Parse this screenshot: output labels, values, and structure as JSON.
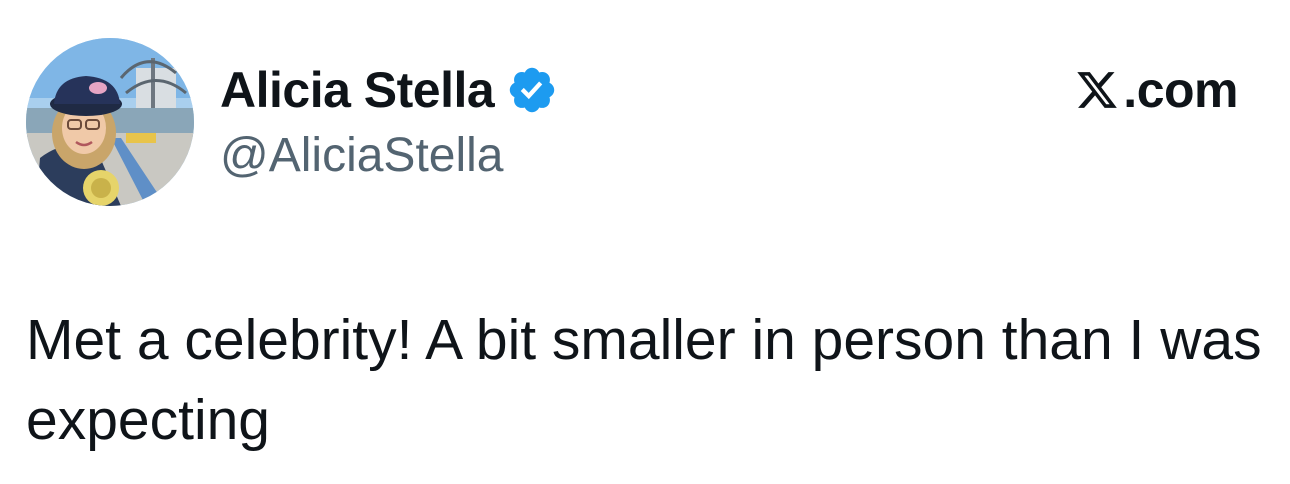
{
  "author": {
    "display_name": "Alicia Stella",
    "handle": "@AliciaStella",
    "verified": true,
    "verified_color": "#1d9bf0",
    "avatar_icon": "profile-photo"
  },
  "source": {
    "domain": ".com",
    "logo_icon": "x-logo-icon"
  },
  "tweet": {
    "text": "Met a celebrity! A bit smaller in person than I was expecting"
  },
  "colors": {
    "text_primary": "#0f1419",
    "text_secondary": "#536471",
    "background": "#ffffff"
  }
}
